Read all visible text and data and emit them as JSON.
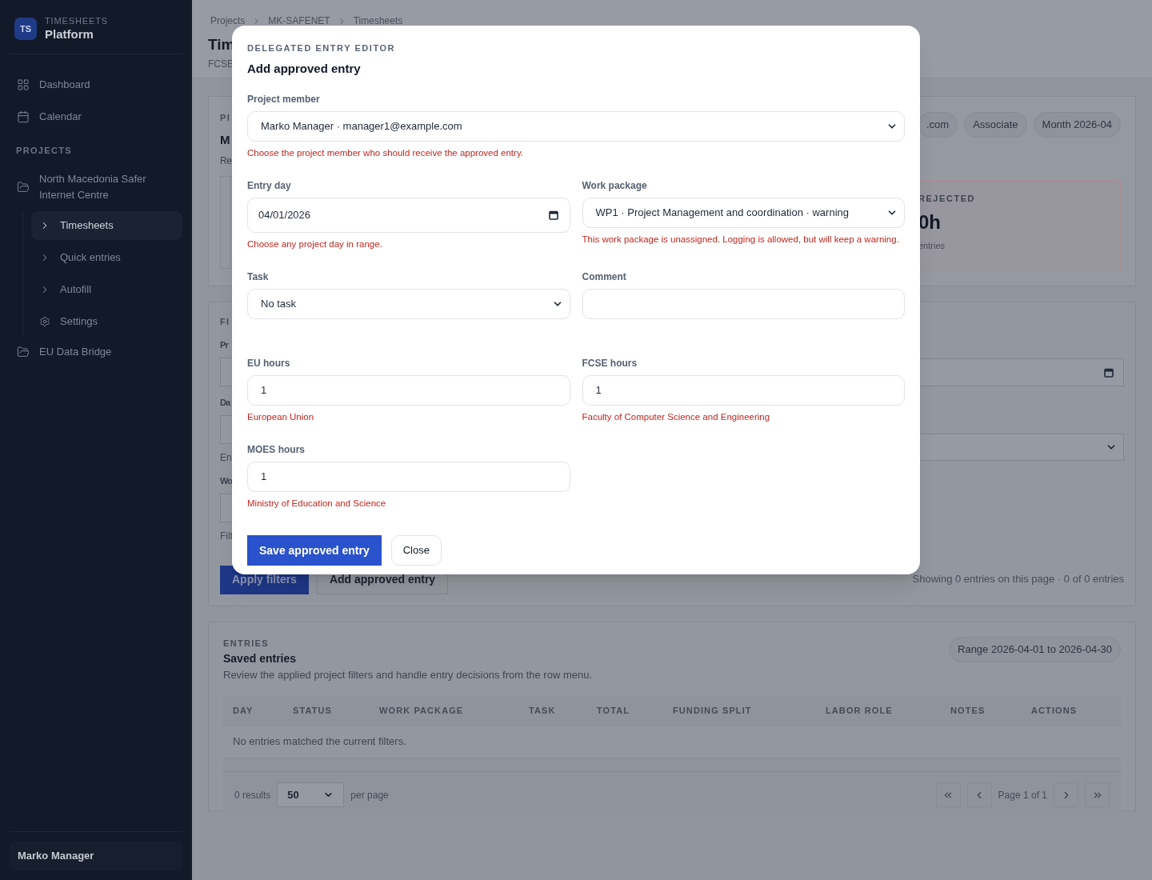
{
  "sidebar": {
    "brand_badge": "TS",
    "brand_eyebrow": "TIMESHEETS",
    "brand_title": "Platform",
    "nav": [
      {
        "label": "Dashboard",
        "kind": "grid"
      },
      {
        "label": "Calendar",
        "kind": "calendar"
      }
    ],
    "section_label": "PROJECTS",
    "projects": [
      {
        "label": "North Macedonia Safer Internet Centre",
        "children": [
          {
            "label": "Timesheets",
            "kind": "page",
            "selected": true
          },
          {
            "label": "Quick entries",
            "kind": "page",
            "selected": false
          },
          {
            "label": "Autofill",
            "kind": "page",
            "selected": false
          },
          {
            "label": "Settings",
            "kind": "settings",
            "selected": false
          }
        ]
      },
      {
        "label": "EU Data Bridge"
      }
    ],
    "user": "Marko Manager"
  },
  "breadcrumb": [
    "Projects",
    "MK-SAFENET",
    "Timesheets"
  ],
  "page_title": "Tim",
  "page_subtitle": "FCSE",
  "summary_card": {
    "eyebrow": "PI",
    "title": "M",
    "text": "Re",
    "chips": [
      ".com",
      "Associate",
      "Month 2026-04"
    ],
    "rejected_card": {
      "label": "REJECTED",
      "value": "0h",
      "caption": "entries"
    }
  },
  "filters_card": {
    "eyebrow": "FI",
    "left": [
      {
        "kind": "label",
        "text": "Pr"
      },
      {
        "kind": "field"
      },
      {
        "kind": "label",
        "text": "Da"
      },
      {
        "kind": "field"
      },
      {
        "kind": "hint",
        "text": "En"
      },
      {
        "kind": "label",
        "text": "Wo"
      },
      {
        "kind": "field"
      },
      {
        "kind": "hint",
        "text": "Filt"
      }
    ],
    "buttons": [
      {
        "label": "Apply filters",
        "kind": "primary"
      },
      {
        "label": "Add approved entry",
        "kind": "secondary"
      }
    ],
    "summary": "Showing 0 entries on this page · 0 of 0 entries"
  },
  "entries_card": {
    "eyebrow": "ENTRIES",
    "title": "Saved entries",
    "description": "Review the applied project filters and handle entry decisions from the row menu.",
    "chip": "Range 2026-04-01 to 2026-04-30",
    "columns": [
      "DAY",
      "STATUS",
      "WORK PACKAGE",
      "TASK",
      "TOTAL",
      "FUNDING SPLIT",
      "LABOR ROLE",
      "NOTES",
      "ACTIONS"
    ],
    "empty_message": "No entries matched the current filters.",
    "results": "0 results",
    "page_size": "50",
    "per_page": "per page",
    "page_label": "Page 1 of 1"
  },
  "modal": {
    "eyebrow": "DELEGATED ENTRY EDITOR",
    "title": "Add approved entry",
    "rows": [
      [
        {
          "label": "Project member",
          "kind": "select",
          "value": "Marko Manager · manager1@example.com",
          "hint": "Choose the project member who should receive the approved entry."
        }
      ],
      [
        {
          "label": "Entry day",
          "kind": "date",
          "value": "04/01/2026",
          "hint": "Choose any project day in range."
        },
        {
          "label": "Work package",
          "kind": "select",
          "value": "WP1 · Project Management and coordination · warning",
          "hint": "This work package is unassigned. Logging is allowed, but will keep a warning."
        }
      ],
      [
        {
          "label": "Task",
          "kind": "select",
          "value": "No task"
        },
        {
          "label": "Comment",
          "kind": "text"
        }
      ],
      [
        {
          "label": "EU hours",
          "kind": "number",
          "value": "1",
          "hint": "European Union"
        },
        {
          "label": "FCSE hours",
          "kind": "number",
          "value": "1",
          "hint": "Faculty of Computer Science and Engineering"
        }
      ],
      [
        {
          "label": "MOES hours",
          "kind": "number",
          "value": "1",
          "hint": "Ministry of Education and Science"
        }
      ]
    ],
    "buttons": [
      {
        "label": "Save approved entry",
        "kind": "primary"
      },
      {
        "label": "Close",
        "kind": "secondary"
      }
    ]
  }
}
